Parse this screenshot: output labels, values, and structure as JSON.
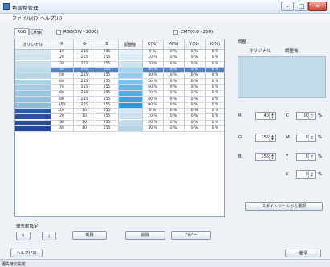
{
  "window": {
    "title": "色調整管理",
    "minimize": "–",
    "maximize": "□",
    "close": "✕"
  },
  "menu": {
    "file": "ファイル(F)",
    "help": "ヘルプ(H)"
  },
  "tabs": [
    {
      "label": "RGB"
    },
    {
      "label": "CMYK"
    }
  ],
  "options": {
    "rgb_range": "RGB(0W~1000)",
    "cmyk_range": "CMY(0.0~250)"
  },
  "table": {
    "headers": [
      "オリジナル",
      "R",
      "G",
      "B",
      "調整後",
      "C(%)",
      "M(%)",
      "Y(%)",
      "K(%)"
    ],
    "rows": [
      {
        "orig": "#d6e9f0",
        "r": "10",
        "g": "255",
        "b": "255",
        "adj": "#e4f2f8",
        "c": "0 %",
        "m": "0 %",
        "y": "0 %",
        "k": "0 %"
      },
      {
        "orig": "#cfe5ee",
        "r": "20",
        "g": "255",
        "b": "255",
        "adj": "#d7ecf5",
        "c": "10 %",
        "m": "0 %",
        "y": "0 %",
        "k": "0 %"
      },
      {
        "orig": "#c8e1ec",
        "r": "30",
        "g": "255",
        "b": "255",
        "adj": "#c9e5f2",
        "c": "20 %",
        "m": "0 %",
        "y": "0 %",
        "k": "0 %"
      },
      {
        "orig": "#bfdcea",
        "r": "40",
        "g": "255",
        "b": "255",
        "adj": "#a9d5ee",
        "c": "30 %",
        "m": "0 %",
        "y": "0 %",
        "k": "0 %"
      },
      {
        "orig": "#b6d7e7",
        "r": "50",
        "g": "255",
        "b": "255",
        "adj": "#92cbeb",
        "c": "40 %",
        "m": "0 %",
        "y": "0 %",
        "k": "0 %"
      },
      {
        "orig": "#add1e4",
        "r": "60",
        "g": "255",
        "b": "255",
        "adj": "#7cc1e8",
        "c": "50 %",
        "m": "0 %",
        "y": "0 %",
        "k": "0 %"
      },
      {
        "orig": "#a4cce1",
        "r": "70",
        "g": "255",
        "b": "255",
        "adj": "#66b6e4",
        "c": "60 %",
        "m": "0 %",
        "y": "0 %",
        "k": "0 %"
      },
      {
        "orig": "#9cc7de",
        "r": "80",
        "g": "255",
        "b": "255",
        "adj": "#52ace1",
        "c": "70 %",
        "m": "0 %",
        "y": "0 %",
        "k": "0 %"
      },
      {
        "orig": "#93c2db",
        "r": "90",
        "g": "255",
        "b": "255",
        "adj": "#3fa2dd",
        "c": "80 %",
        "m": "0 %",
        "y": "0 %",
        "k": "0 %"
      },
      {
        "orig": "#8bbdd8",
        "r": "100",
        "g": "255",
        "b": "255",
        "adj": "#2e98da",
        "c": "90 %",
        "m": "0 %",
        "y": "0 %",
        "k": "0 %"
      },
      {
        "orig": "#2f58a8",
        "r": "10",
        "g": "10",
        "b": "255",
        "adj": "#d9e7f4",
        "c": "0 %",
        "m": "0 %",
        "y": "0 %",
        "k": "0 %"
      },
      {
        "orig": "#2b52a2",
        "r": "20",
        "g": "10",
        "b": "255",
        "adj": "#cde0f1",
        "c": "10 %",
        "m": "0 %",
        "y": "0 %",
        "k": "0 %"
      },
      {
        "orig": "#284d9d",
        "r": "30",
        "g": "10",
        "b": "255",
        "adj": "#c2daee",
        "c": "20 %",
        "m": "0 %",
        "y": "0 %",
        "k": "0 %"
      },
      {
        "orig": "#244898",
        "r": "40",
        "g": "10",
        "b": "255",
        "adj": "#b6d3ea",
        "c": "30 %",
        "m": "0 %",
        "y": "0 %",
        "k": "0 %"
      }
    ],
    "selected_row": 3
  },
  "adjust": {
    "title": "調整",
    "original_label": "オリジナル",
    "adjusted_label": "調整後",
    "preview_color": "#c1dbe9",
    "fields": [
      {
        "label": "R",
        "value": "40"
      },
      {
        "label": "G",
        "value": "255"
      },
      {
        "label": "B",
        "value": "255"
      },
      {
        "label": "C",
        "value": "30"
      },
      {
        "label": "M",
        "value": "0"
      },
      {
        "label": "Y",
        "value": "0"
      },
      {
        "label": "K",
        "value": "0"
      }
    ],
    "percent": "%",
    "pick_button": "スポイトツールから選択"
  },
  "order": {
    "title": "優先度設定",
    "up": "↑",
    "down": "↓"
  },
  "actions": {
    "new": "新規",
    "delete": "削除",
    "copy": "コピー"
  },
  "footer": {
    "help": "ヘルプ(F1)",
    "save": "登録"
  },
  "status": {
    "text": "優先度の設定"
  }
}
